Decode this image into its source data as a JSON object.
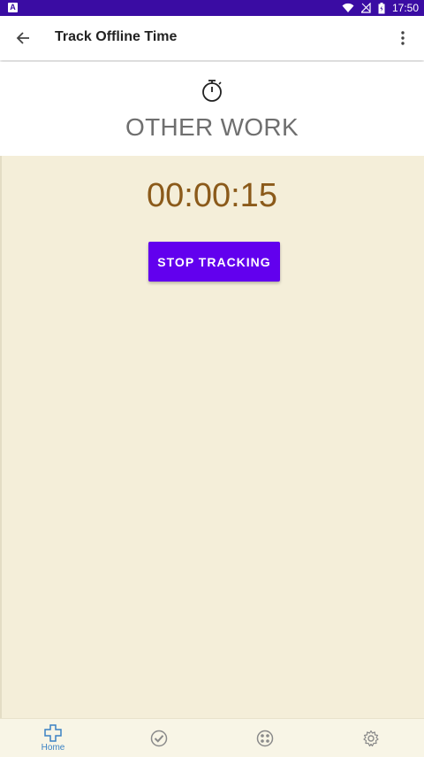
{
  "status_bar": {
    "time": "17:50",
    "notification_icon": "a-icon",
    "icons": [
      "wifi-icon",
      "signal-icon",
      "battery-icon"
    ]
  },
  "app_bar": {
    "title": "Track Offline Time",
    "back_icon": "arrow-left-icon",
    "menu_icon": "more-vert-icon"
  },
  "activity": {
    "icon": "stopwatch-icon",
    "name": "OTHER WORK"
  },
  "tracker": {
    "elapsed": "00:00:15",
    "stop_label": "STOP TRACKING"
  },
  "bottom_nav": {
    "items": [
      {
        "icon": "home-cross-icon",
        "label": "Home",
        "active": true
      },
      {
        "icon": "check-circle-icon",
        "label": "",
        "active": false
      },
      {
        "icon": "apps-circle-icon",
        "label": "",
        "active": false
      },
      {
        "icon": "settings-gear-icon",
        "label": "",
        "active": false
      }
    ]
  },
  "colors": {
    "status_bar": "#3a0ca3",
    "primary_button": "#6200ee",
    "tracking_background": "#f4eed9",
    "timer_text": "#8b5a1a",
    "nav_active": "#3b82c4"
  }
}
